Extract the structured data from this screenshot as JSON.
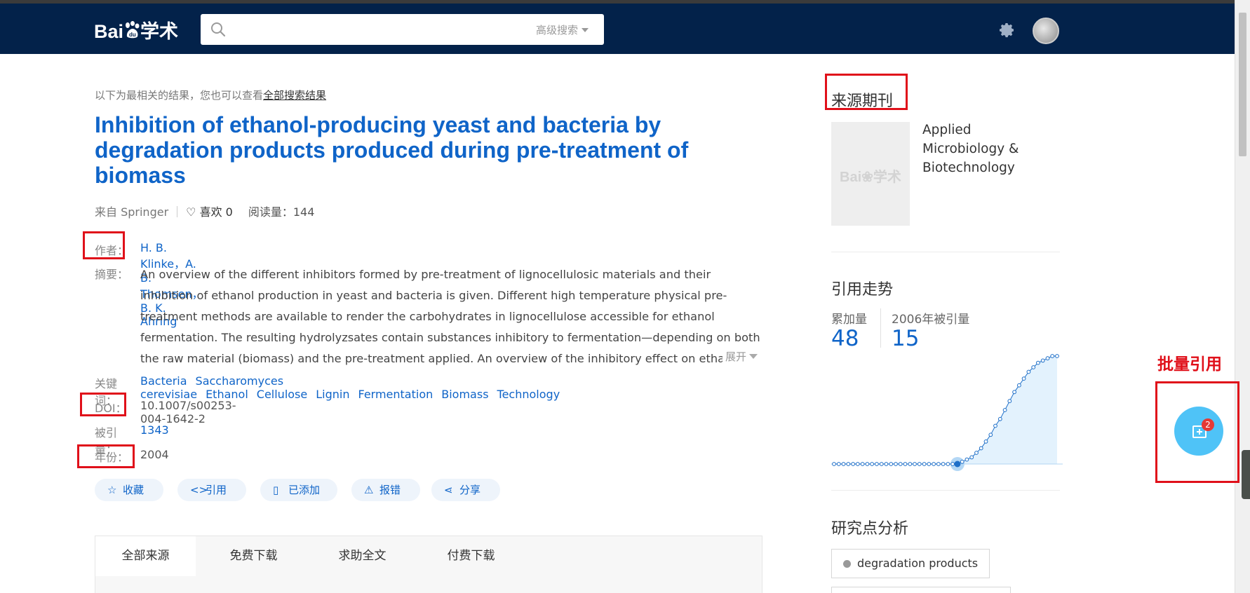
{
  "header": {
    "logo_text_left": "Bai",
    "logo_text_right": "学术",
    "search_value": "",
    "advanced_search": "高级搜索",
    "colors": {
      "bar": "#03224a",
      "accent": "#0f64c8",
      "annotation": "#e0101a"
    }
  },
  "result": {
    "hint_prefix": "以下为最相关的结果，您也可以查看",
    "hint_link": "全部搜索结果",
    "title": "Inhibition of ethanol-producing yeast and bacteria by degradation products produced during pre-treatment of biomass",
    "source": "来自 Springer",
    "like": "喜欢 0",
    "read": "阅读量：144",
    "authors_label": "作者：",
    "authors": "H. B. Klinke，A. B. Thomsen，B. K. Ahring",
    "abstract_label": "摘要：",
    "abstract": "An overview of the different inhibitors formed by pre-treatment of lignocellulosic materials and their inhibition of ethanol production in yeast and bacteria is given. Different high temperature physical pre-treatment methods are available to render the carbohydrates in lignocellulose accessible for ethanol fermentation. The resulting hydrolyzsates contain substances inhibitory to fermentation—depending on both the raw material (biomass) and the pre-treatment applied. An overview of the inhibitory effect on ethanol production by yeast and bacteria",
    "expand": "展开",
    "keywords_label": "关键词：",
    "keywords": [
      "Bacteria",
      "Saccharomyces cerevisiae",
      "Ethanol",
      "Cellulose",
      "Lignin",
      "Fermentation",
      "Biomass",
      "Technology"
    ],
    "doi_label": "DOI：",
    "doi": "10.1007/s00253-004-1642-2",
    "cited_label": "被引量：",
    "cited": "1343",
    "year_label": "年份：",
    "year": "2004"
  },
  "actions": [
    {
      "label": "收藏",
      "icon": "star-icon"
    },
    {
      "label": "引用",
      "icon": "code-icon"
    },
    {
      "label": "已添加",
      "icon": "bookmark-icon"
    },
    {
      "label": "报错",
      "icon": "warning-icon"
    },
    {
      "label": "分享",
      "icon": "share-icon"
    }
  ],
  "tabs": [
    "全部来源",
    "免费下载",
    "求助全文",
    "付费下载"
  ],
  "sidebar": {
    "journal_title": "来源期刊",
    "journal_name": "Applied Microbiology & Biotechnology",
    "citation_title": "引用走势",
    "cumulative_label": "累加量",
    "cumulative_value": "48",
    "year_cited_label": "2006年被引量",
    "year_cited_value": "15",
    "research_title": "研究点分析",
    "research_tag": "degradation products"
  },
  "chart_data": {
    "type": "area",
    "points": [
      0,
      0,
      0,
      0,
      0,
      0,
      0,
      0,
      0,
      0,
      0,
      0,
      0,
      0,
      0,
      0,
      0,
      0,
      0,
      0,
      0,
      0,
      0,
      0,
      0,
      0,
      0,
      1,
      2,
      3,
      5,
      7,
      10,
      13,
      17,
      20,
      24,
      28,
      32,
      35,
      38,
      41,
      43,
      45,
      46,
      47,
      48,
      48
    ],
    "highlight_index": 26
  },
  "batch_cite": {
    "label": "批量引用",
    "badge": "2"
  }
}
